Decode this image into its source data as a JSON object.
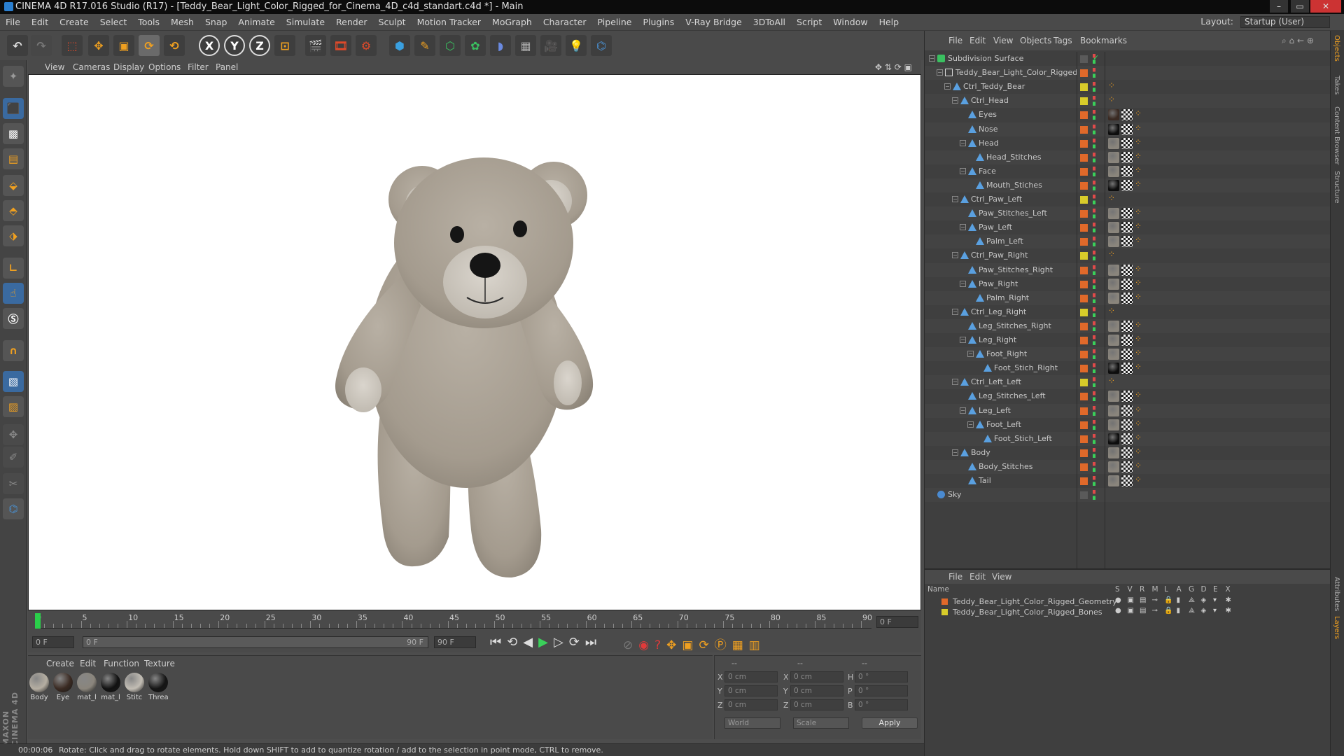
{
  "window": {
    "title": "CINEMA 4D R17.016 Studio (R17) - [Teddy_Bear_Light_Color_Rigged_for_Cinema_4D_c4d_standart.c4d *] - Main"
  },
  "menu": [
    "File",
    "Edit",
    "Create",
    "Select",
    "Tools",
    "Mesh",
    "Snap",
    "Animate",
    "Simulate",
    "Render",
    "Sculpt",
    "Motion Tracker",
    "MoGraph",
    "Character",
    "Pipeline",
    "Plugins",
    "V-Ray Bridge",
    "3DToAll",
    "Script",
    "Window",
    "Help"
  ],
  "layout": {
    "label": "Layout:",
    "value": "Startup (User)"
  },
  "toolbar": {
    "x": "X",
    "y": "Y",
    "z": "Z"
  },
  "viewport_menu": [
    "View",
    "Cameras",
    "Display",
    "Options",
    "Filter",
    "Panel"
  ],
  "timeline": {
    "ticks": [
      "0",
      "5",
      "10",
      "15",
      "20",
      "25",
      "30",
      "35",
      "40",
      "45",
      "50",
      "55",
      "60",
      "65",
      "70",
      "75",
      "80",
      "85",
      "90"
    ],
    "current_frame": "0 F",
    "start": "0 F",
    "range_start": "0 F",
    "range_end": "90 F",
    "end": "90 F"
  },
  "materials_menu": [
    "Create",
    "Edit",
    "Function",
    "Texture"
  ],
  "materials": [
    {
      "label": "Body",
      "color": "#b5aea2"
    },
    {
      "label": "Eye",
      "color": "#3a2a22"
    },
    {
      "label": "mat_l",
      "color": "#8a857c"
    },
    {
      "label": "mat_l",
      "color": "#111111"
    },
    {
      "label": "Stitc",
      "color": "#c2bdb4"
    },
    {
      "label": "Threa",
      "color": "#151515"
    }
  ],
  "coords": {
    "header": [
      "--",
      "--",
      "--"
    ],
    "rows": [
      {
        "a": "X",
        "av": "0 cm",
        "b": "X",
        "bv": "0 cm",
        "c": "H",
        "cv": "0 °"
      },
      {
        "a": "Y",
        "av": "0 cm",
        "b": "Y",
        "bv": "0 cm",
        "c": "P",
        "cv": "0 °"
      },
      {
        "a": "Z",
        "av": "0 cm",
        "b": "Z",
        "bv": "0 cm",
        "c": "B",
        "cv": "0 °"
      }
    ],
    "mode1": "World",
    "mode2": "Scale",
    "apply": "Apply"
  },
  "status": {
    "time": "00:00:06",
    "message": "Rotate: Click and drag to rotate elements. Hold down SHIFT to add to quantize rotation / add to the selection in point mode, CTRL to remove."
  },
  "objects_menu": [
    "File",
    "Edit",
    "View",
    "Objects",
    "Tags",
    "Bookmarks"
  ],
  "objects": [
    {
      "name": "Subdivision Surface",
      "depth": 0,
      "type": "subdiv",
      "layer": "",
      "fold": "-"
    },
    {
      "name": "Teddy_Bear_Light_Color_Rigged",
      "depth": 1,
      "type": "null",
      "layer": "orange",
      "fold": "-"
    },
    {
      "name": "Ctrl_Teddy_Bear",
      "depth": 2,
      "type": "joint",
      "layer": "yellow",
      "fold": "-"
    },
    {
      "name": "Ctrl_Head",
      "depth": 3,
      "type": "joint",
      "layer": "yellow",
      "fold": "-"
    },
    {
      "name": "Eyes",
      "depth": 4,
      "type": "joint",
      "layer": "orange",
      "fold": "",
      "tag": "dark"
    },
    {
      "name": "Nose",
      "depth": 4,
      "type": "joint",
      "layer": "orange",
      "fold": "",
      "tag": "black"
    },
    {
      "name": "Head",
      "depth": 4,
      "type": "joint",
      "layer": "orange",
      "fold": "-",
      "tag": "fur"
    },
    {
      "name": "Head_Stitches",
      "depth": 5,
      "type": "joint",
      "layer": "orange",
      "fold": "",
      "tag": "fur"
    },
    {
      "name": "Face",
      "depth": 4,
      "type": "joint",
      "layer": "orange",
      "fold": "-",
      "tag": "fur"
    },
    {
      "name": "Mouth_Stiches",
      "depth": 5,
      "type": "joint",
      "layer": "orange",
      "fold": "",
      "tag": "black"
    },
    {
      "name": "Ctrl_Paw_Left",
      "depth": 3,
      "type": "joint",
      "layer": "yellow",
      "fold": "-"
    },
    {
      "name": "Paw_Stitches_Left",
      "depth": 4,
      "type": "joint",
      "layer": "orange",
      "fold": "",
      "tag": "fur"
    },
    {
      "name": "Paw_Left",
      "depth": 4,
      "type": "joint",
      "layer": "orange",
      "fold": "-",
      "tag": "fur"
    },
    {
      "name": "Palm_Left",
      "depth": 5,
      "type": "joint",
      "layer": "orange",
      "fold": "",
      "tag": "fur"
    },
    {
      "name": "Ctrl_Paw_Right",
      "depth": 3,
      "type": "joint",
      "layer": "yellow",
      "fold": "-"
    },
    {
      "name": "Paw_Stitches_Right",
      "depth": 4,
      "type": "joint",
      "layer": "orange",
      "fold": "",
      "tag": "fur"
    },
    {
      "name": "Paw_Right",
      "depth": 4,
      "type": "joint",
      "layer": "orange",
      "fold": "-",
      "tag": "fur"
    },
    {
      "name": "Palm_Right",
      "depth": 5,
      "type": "joint",
      "layer": "orange",
      "fold": "",
      "tag": "fur"
    },
    {
      "name": "Ctrl_Leg_Right",
      "depth": 3,
      "type": "joint",
      "layer": "yellow",
      "fold": "-"
    },
    {
      "name": "Leg_Stitches_Right",
      "depth": 4,
      "type": "joint",
      "layer": "orange",
      "fold": "",
      "tag": "fur"
    },
    {
      "name": "Leg_Right",
      "depth": 4,
      "type": "joint",
      "layer": "orange",
      "fold": "-",
      "tag": "fur"
    },
    {
      "name": "Foot_Right",
      "depth": 5,
      "type": "joint",
      "layer": "orange",
      "fold": "-",
      "tag": "fur"
    },
    {
      "name": "Foot_Stich_Right",
      "depth": 6,
      "type": "joint",
      "layer": "orange",
      "fold": "",
      "tag": "black"
    },
    {
      "name": "Ctrl_Left_Left",
      "depth": 3,
      "type": "joint",
      "layer": "yellow",
      "fold": "-"
    },
    {
      "name": "Leg_Stitches_Left",
      "depth": 4,
      "type": "joint",
      "layer": "orange",
      "fold": "",
      "tag": "fur"
    },
    {
      "name": "Leg_Left",
      "depth": 4,
      "type": "joint",
      "layer": "orange",
      "fold": "-",
      "tag": "fur"
    },
    {
      "name": "Foot_Left",
      "depth": 5,
      "type": "joint",
      "layer": "orange",
      "fold": "-",
      "tag": "fur"
    },
    {
      "name": "Foot_Stich_Left",
      "depth": 6,
      "type": "joint",
      "layer": "orange",
      "fold": "",
      "tag": "black"
    },
    {
      "name": "Body",
      "depth": 3,
      "type": "joint",
      "layer": "orange",
      "fold": "-",
      "tag": "fur"
    },
    {
      "name": "Body_Stitches",
      "depth": 4,
      "type": "joint",
      "layer": "orange",
      "fold": "",
      "tag": "fur"
    },
    {
      "name": "Tail",
      "depth": 4,
      "type": "joint",
      "layer": "orange",
      "fold": "",
      "tag": "fur"
    },
    {
      "name": "Sky",
      "depth": 0,
      "type": "sky",
      "layer": "",
      "fold": ""
    }
  ],
  "layers_menu": [
    "File",
    "Edit",
    "View"
  ],
  "layers_header": {
    "name": "Name",
    "cols": [
      "S",
      "V",
      "R",
      "M",
      "L",
      "A",
      "G",
      "D",
      "E",
      "X"
    ]
  },
  "layers": [
    {
      "name": "Teddy_Bear_Light_Color_Rigged_Geometry",
      "color": "#e0692a"
    },
    {
      "name": "Teddy_Bear_Light_Color_Rigged_Bones",
      "color": "#d8cc2a"
    }
  ],
  "side_tabs": [
    "Objects",
    "Takes",
    "Content Browser",
    "Structure",
    "Attributes",
    "Layers"
  ],
  "colors": {
    "orange": "#e0692a",
    "yellow": "#d8cc2a",
    "joint": "#5aa0e0",
    "accent": "#2a7fd0"
  }
}
